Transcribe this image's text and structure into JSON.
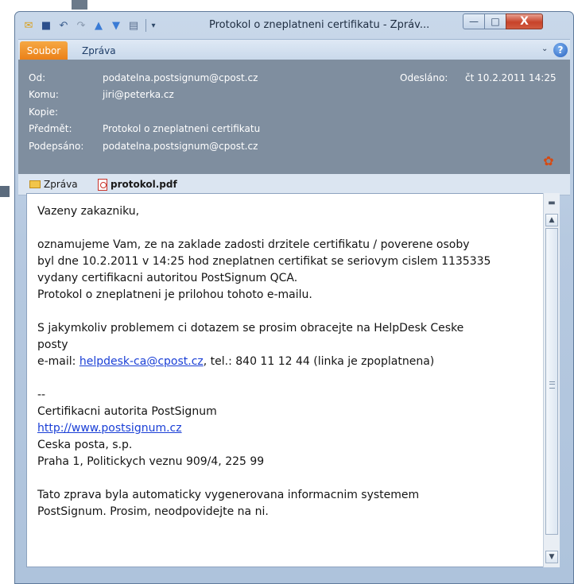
{
  "window": {
    "title": "Protokol o zneplatneni certifikatu - Zpráv...",
    "icons": [
      "mail-icon",
      "save-icon",
      "undo-icon",
      "redo-icon",
      "up-arrow-icon",
      "down-arrow-icon",
      "print-icon",
      "customize-icon"
    ],
    "controls": {
      "minimize": "—",
      "maximize": "□",
      "close": "X"
    }
  },
  "ribbon": {
    "tabs": [
      "Soubor",
      "Zpráva"
    ],
    "active_tab_color": "#ea7f16",
    "caret": "⌄",
    "help": "?"
  },
  "header": {
    "from_label": "Od:",
    "from_value": "podatelna.postsignum@cpost.cz",
    "to_label": "Komu:",
    "to_value": "jiri@peterka.cz",
    "cc_label": "Kopie:",
    "cc_value": "",
    "subject_label": "Předmět:",
    "subject_value": "Protokol o zneplatneni certifikatu",
    "signed_label": "Podepsáno:",
    "signed_value": "podatelna.postsignum@cpost.cz",
    "sent_label": "Odesláno:",
    "sent_value": "čt 10.2.2011 14:25"
  },
  "attachments": {
    "message_label": "Zpráva",
    "file_label": "protokol.pdf"
  },
  "body": {
    "greeting": "Vazeny zakazniku,",
    "p1_l1": "oznamujeme Vam, ze na zaklade zadosti drzitele certifikatu / poverene osoby",
    "p1_l2": "byl dne 10.2.2011 v 14:25 hod zneplatnen certifikat se seriovym cislem 1135335",
    "p1_l3": "vydany certifikacni autoritou PostSignum QCA.",
    "p1_l4": "Protokol o zneplatneni je prilohou tohoto e-mailu.",
    "p2_l1": "S jakymkoliv problemem ci dotazem se prosim obracejte na HelpDesk Ceske",
    "p2_l2": "posty",
    "p2_l3_prefix": "e-mail: ",
    "p2_link": "helpdesk-ca@cpost.cz",
    "p2_l3_suffix": ", tel.: 840 11 12 44 (linka je zpoplatnena)",
    "sig_dashes": "--",
    "sig_l1": "Certifikacni autorita PostSignum",
    "sig_link": "http://www.postsignum.cz",
    "sig_l3": "Ceska posta, s.p.",
    "sig_l4": "Praha 1, Politickych veznu 909/4, 225 99",
    "p3_l1": "Tato zprava byla automaticky vygenerovana informacnim systemem",
    "p3_l2": "PostSignum. Prosim, neodpovidejte na ni."
  },
  "scrollbar": {
    "up": "▲",
    "down": "▼"
  }
}
